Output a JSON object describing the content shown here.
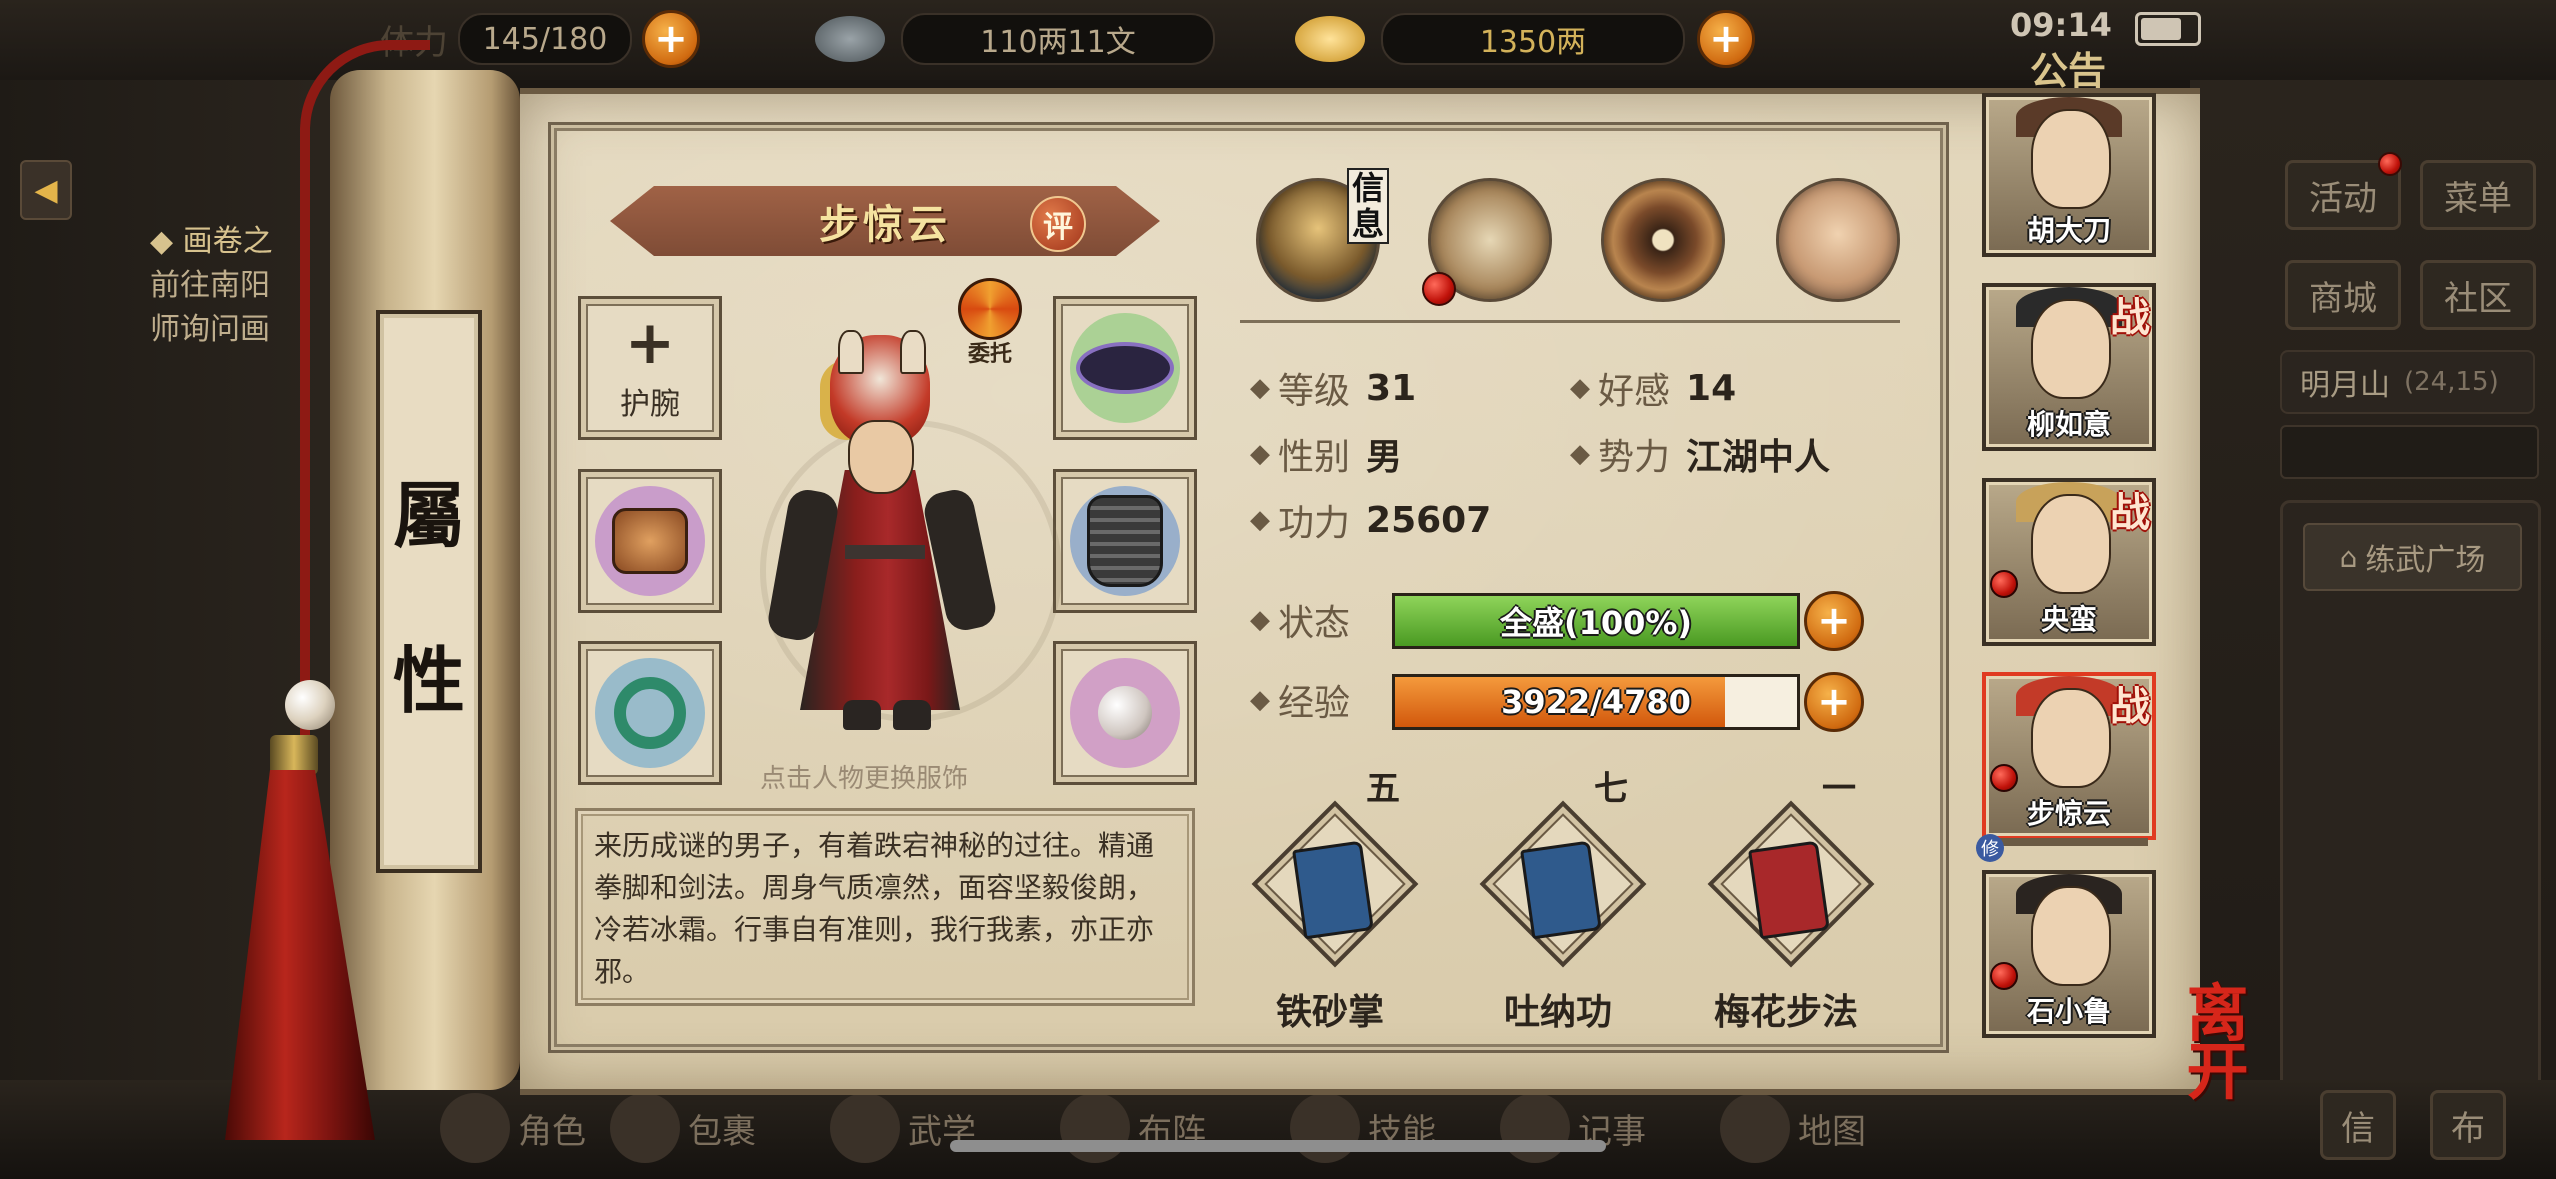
{
  "status_bar": {
    "time": "09:14"
  },
  "top_bar": {
    "stamina_label": "体力",
    "stamina": "145/180",
    "silver": "110两11文",
    "gold": "1350两",
    "announcement": "公告"
  },
  "quest": {
    "title": "画卷之",
    "line1": "前往南阳",
    "line2": "师询问画"
  },
  "right_menu": {
    "activity": "活动",
    "menu": "菜单",
    "mall": "商城",
    "community": "社区",
    "location": "明月山",
    "coords": "(24,15)",
    "training_ground": "练武广场"
  },
  "bottom_nav": [
    "角色",
    "包裹",
    "武学",
    "布阵",
    "技能",
    "记事",
    "地图"
  ],
  "bottom_nav_right": [
    "信",
    "布"
  ],
  "scroll": {
    "label_top": "屬",
    "label_bottom": "性"
  },
  "character": {
    "name": "步惊云",
    "rate_badge": "评",
    "entrust_label": "委托",
    "change_outfit_hint": "点击人物更换服饰",
    "description": "来历成谜的男子，有着跌宕神秘的过往。精通拳脚和剑法。周身气质凛然，面容坚毅俊朗，冷若冰霜。行事自有准则，我行我素，亦正亦邪。"
  },
  "equipment": {
    "wrist_empty_label": "护腕"
  },
  "tabs": {
    "info_label": "信息"
  },
  "stats": {
    "level_label": "等级",
    "level": "31",
    "favor_label": "好感",
    "favor": "14",
    "gender_label": "性别",
    "gender": "男",
    "faction_label": "势力",
    "faction": "江湖中人",
    "power_label": "功力",
    "power": "25607",
    "state_label": "状态",
    "state_text": "全盛(100%)",
    "state_fraction": 1.0,
    "exp_label": "经验",
    "exp_text": "3922/4780",
    "exp_fraction": 0.8205
  },
  "skills": [
    {
      "name": "铁砂掌",
      "level": "五",
      "book_color": "#2f5a8c"
    },
    {
      "name": "吐纳功",
      "level": "七",
      "book_color": "#2f5a8c"
    },
    {
      "name": "梅花步法",
      "level": "一",
      "book_color": "#a8282a"
    }
  ],
  "roster": [
    {
      "name": "胡大刀",
      "battle": "",
      "dot": false
    },
    {
      "name": "柳如意",
      "battle": "战",
      "dot": false
    },
    {
      "name": "央蛮",
      "battle": "战",
      "dot": true
    },
    {
      "name": "步惊云",
      "battle": "战",
      "dot": true
    },
    {
      "name": "石小鲁",
      "battle": "",
      "dot": true
    }
  ],
  "roster_tag": "修",
  "leave_label": "离开",
  "colors": {
    "state_bar": "#5cae2e",
    "exp_bar": "#e06a14",
    "accent": "#d6261a"
  }
}
